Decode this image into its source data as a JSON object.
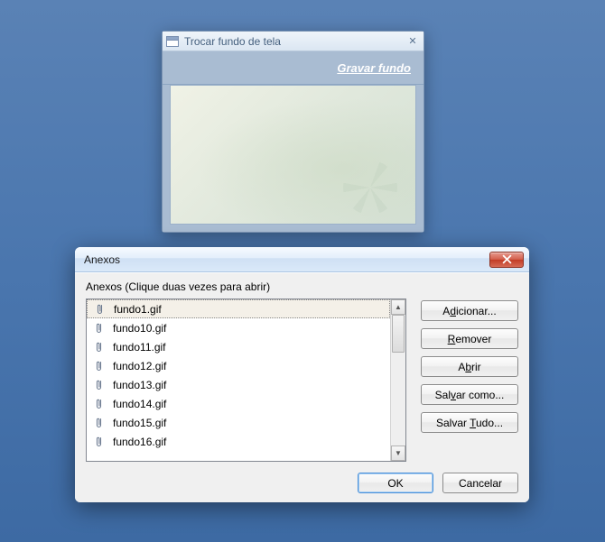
{
  "win1": {
    "title": "Trocar fundo de tela",
    "link": "Gravar fundo"
  },
  "dialog": {
    "title": "Anexos",
    "list_label": "Anexos (Clique duas vezes para abrir)",
    "items": [
      {
        "name": "fundo1.gif",
        "selected": true
      },
      {
        "name": "fundo10.gif",
        "selected": false
      },
      {
        "name": "fundo11.gif",
        "selected": false
      },
      {
        "name": "fundo12.gif",
        "selected": false
      },
      {
        "name": "fundo13.gif",
        "selected": false
      },
      {
        "name": "fundo14.gif",
        "selected": false
      },
      {
        "name": "fundo15.gif",
        "selected": false
      },
      {
        "name": "fundo16.gif",
        "selected": false
      }
    ],
    "buttons": {
      "add": {
        "pre": "A",
        "accel": "d",
        "post": "icionar..."
      },
      "remove": {
        "pre": "",
        "accel": "R",
        "post": "emover"
      },
      "open": {
        "pre": "A",
        "accel": "b",
        "post": "rir"
      },
      "saveas": {
        "pre": "Sal",
        "accel": "v",
        "post": "ar como..."
      },
      "saveall": {
        "pre": "Salvar ",
        "accel": "T",
        "post": "udo..."
      },
      "ok": "OK",
      "cancel": "Cancelar"
    }
  }
}
